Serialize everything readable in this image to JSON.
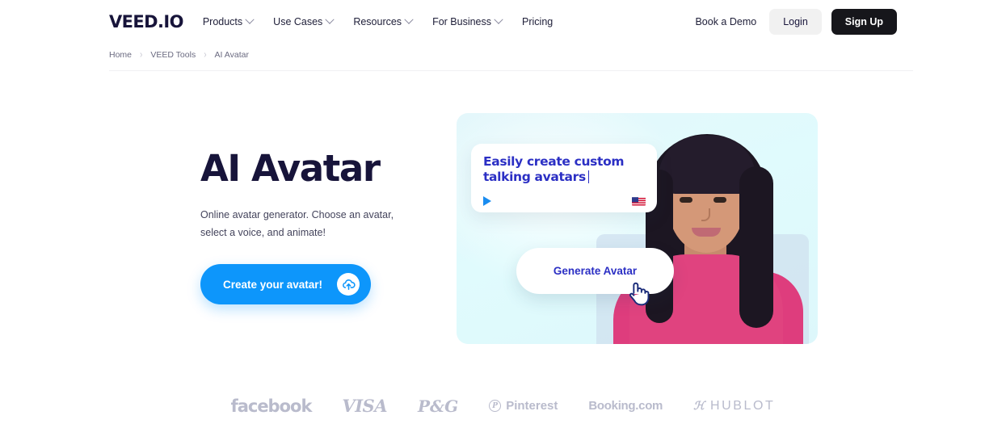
{
  "header": {
    "logo": "VEED.IO",
    "nav": [
      {
        "label": "Products",
        "has_chevron": true
      },
      {
        "label": "Use Cases",
        "has_chevron": true
      },
      {
        "label": "Resources",
        "has_chevron": true
      },
      {
        "label": "For Business",
        "has_chevron": true
      },
      {
        "label": "Pricing",
        "has_chevron": false
      }
    ],
    "book_demo": "Book a Demo",
    "login": "Login",
    "signup": "Sign Up"
  },
  "breadcrumb": {
    "home": "Home",
    "sep1": "›",
    "tools": "VEED Tools",
    "sep2": "›",
    "current": "AI Avatar"
  },
  "hero": {
    "title": "AI Avatar",
    "subtitle": "Online avatar generator. Choose an avatar, select a voice, and animate!",
    "cta_label": "Create your avatar!",
    "cta_icon": "upload-cloud-icon"
  },
  "hero_card": {
    "caption_line1": "Easily create custom",
    "caption_line2": "talking avatars",
    "play_icon": "play-icon",
    "flag_icon": "us-flag-icon",
    "generate_button": "Generate Avatar",
    "cursor_icon": "hand-pointer-cursor"
  },
  "logobar": [
    {
      "name": "facebook",
      "label": "facebook"
    },
    {
      "name": "visa",
      "label": "VISA"
    },
    {
      "name": "pg",
      "label": "P&G"
    },
    {
      "name": "pinterest",
      "label": "Pinterest",
      "mark": "P"
    },
    {
      "name": "booking",
      "label": "Booking.com"
    },
    {
      "name": "hublot",
      "label": "HUBLOT"
    }
  ],
  "colors": {
    "brand_blue": "#0d96fb",
    "ink": "#17143a",
    "caption_blue": "#2b2fc4",
    "signup_black": "#16161b",
    "card_cyan": "#e0fbfd",
    "logo_gray": "#b9bbcc"
  }
}
